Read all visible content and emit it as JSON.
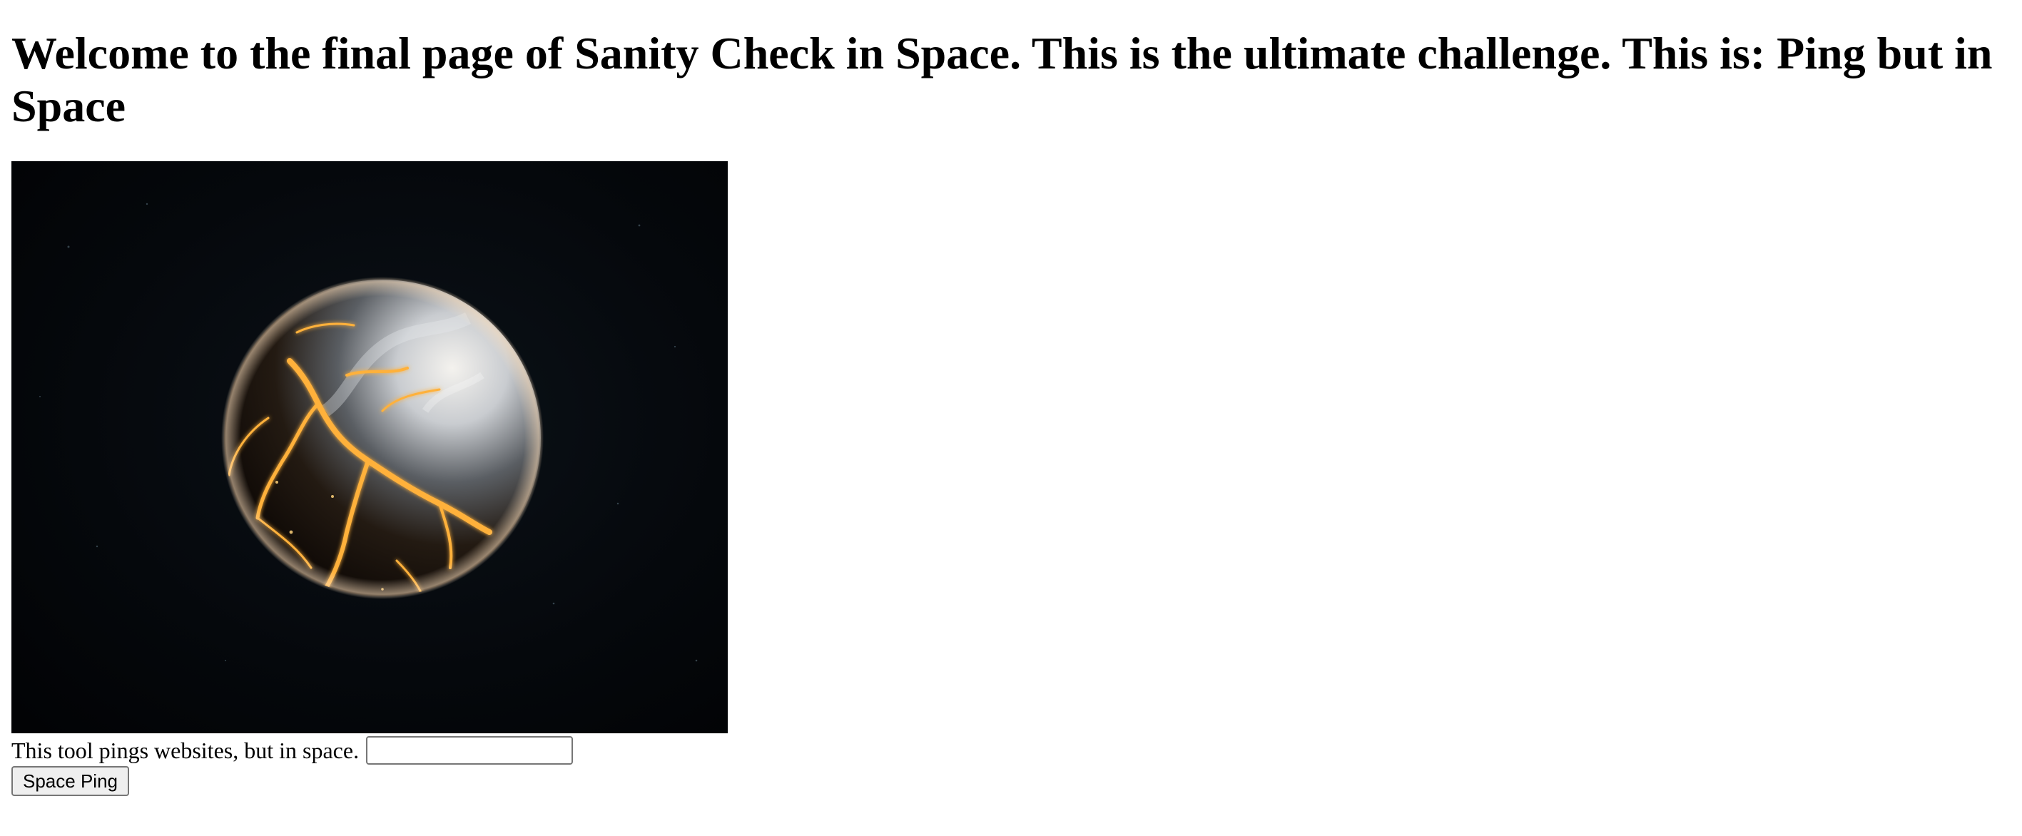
{
  "heading": "Welcome to the final page of Sanity Check in Space. This is the ultimate challenge. This is: Ping but in Space",
  "hero_image": {
    "icon": "cracked-glowing-planet-in-space"
  },
  "ping_form": {
    "label": "This tool pings websites, but in space.",
    "input_value": "",
    "input_placeholder": "",
    "button_label": "Space Ping"
  },
  "colors": {
    "space_background": "#05070b",
    "lava_glow": "#ffb13b",
    "planet_light": "#dfe3e8"
  }
}
